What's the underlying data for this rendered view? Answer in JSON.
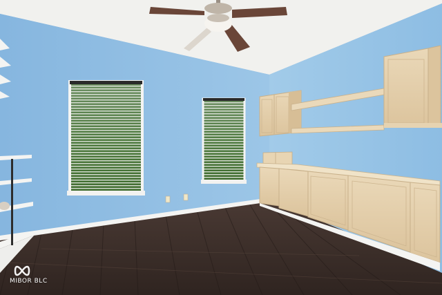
{
  "watermark": {
    "text": "MIBOR BLC"
  }
}
